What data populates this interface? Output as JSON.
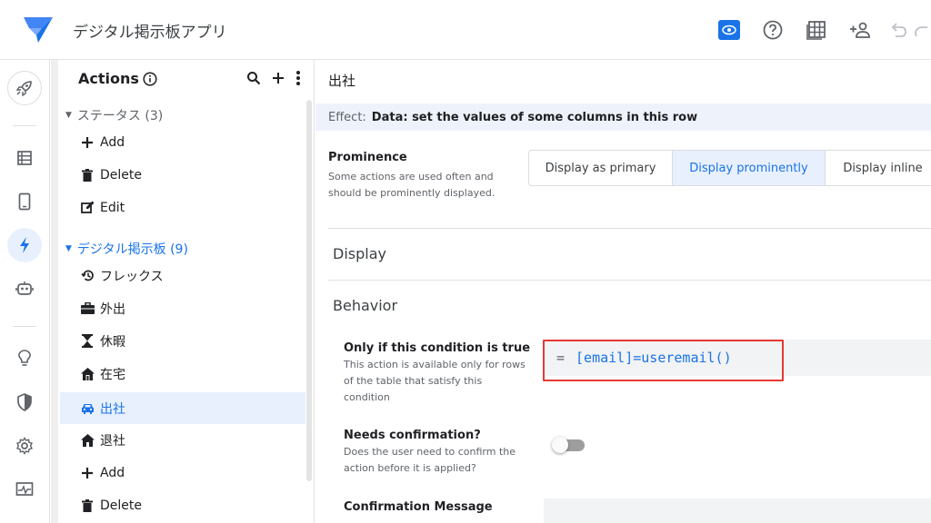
{
  "header": {
    "app_title": "デジタル掲示板アプリ",
    "icons": [
      "preview-icon",
      "help-icon",
      "table-icon",
      "add-person-icon",
      "undo-icon",
      "redo-icon"
    ]
  },
  "rail": {
    "icons": [
      "rocket-icon",
      "data-icon",
      "ux-icon",
      "actions-icon",
      "bot-icon",
      "intelligence-icon",
      "security-icon",
      "settings-icon",
      "monitor-icon"
    ],
    "active": "actions-icon"
  },
  "actions_panel": {
    "title": "Actions",
    "groups": [
      {
        "label": "ステータス (3)",
        "items": [
          {
            "label": "Add",
            "icon": "plus-icon"
          },
          {
            "label": "Delete",
            "icon": "trash-icon"
          },
          {
            "label": "Edit",
            "icon": "edit-icon"
          }
        ]
      },
      {
        "label": "デジタル掲示板 (9)",
        "items": [
          {
            "label": "フレックス",
            "icon": "history-icon"
          },
          {
            "label": "外出",
            "icon": "briefcase-icon"
          },
          {
            "label": "休暇",
            "icon": "hourglass-icon"
          },
          {
            "label": "在宅",
            "icon": "house-icon"
          },
          {
            "label": "出社",
            "icon": "car-icon",
            "selected": true
          },
          {
            "label": "退社",
            "icon": "home-icon"
          },
          {
            "label": "Add",
            "icon": "plus-icon"
          },
          {
            "label": "Delete",
            "icon": "trash-icon"
          }
        ]
      }
    ]
  },
  "main": {
    "title": "出社",
    "effect_label": "Effect:",
    "effect_value": "Data: set the values of some columns in this row",
    "prominence": {
      "heading": "Prominence",
      "description": "Some actions are used often and should be prominently displayed.",
      "options": [
        "Display as primary",
        "Display prominently",
        "Display inline"
      ],
      "selected": "Display prominently"
    },
    "display_section": "Display",
    "behavior_section": "Behavior",
    "condition": {
      "heading": "Only if this condition is true",
      "description": "This action is available only for rows of the table that satisfy this condition",
      "eq": "=",
      "expression": "[email]=useremail()"
    },
    "confirmation": {
      "heading": "Needs confirmation?",
      "description": "Does the user need to confirm the action before it is applied?",
      "enabled": false
    },
    "confirmation_message": {
      "heading": "Confirmation Message"
    }
  },
  "colors": {
    "accent": "#1a73e8",
    "selected_bg": "#e8f0fe",
    "highlight_border": "#e53935"
  }
}
